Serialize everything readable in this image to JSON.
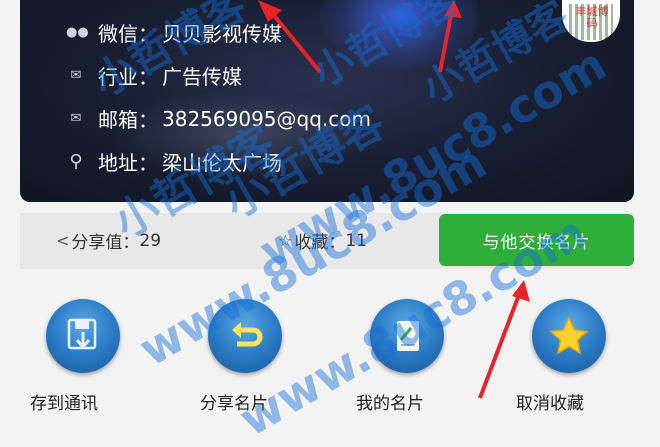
{
  "card": {
    "wechat": {
      "icon": "wechat-icon",
      "label": "微信：",
      "value": "贝贝影视传媒"
    },
    "industry": {
      "icon": "mail-icon",
      "label": "行业：",
      "value": "广告传媒"
    },
    "email": {
      "icon": "mail-icon",
      "label": "邮箱：",
      "value": "382569095@qq.com"
    },
    "address": {
      "icon": "location-pin-icon",
      "label": "地址：",
      "value": "梁山伦太广场"
    },
    "qr_caption": "丰城博码"
  },
  "stats": {
    "share": {
      "icon": "share-icon",
      "label": "分享值：",
      "value": "29"
    },
    "fav": {
      "icon": "star-outline-icon",
      "label": "收藏：",
      "value": "11"
    },
    "exchange_button": "与他交换名片"
  },
  "actions": [
    {
      "icon": "save-download-icon",
      "label": "存到通讯"
    },
    {
      "icon": "return-icon",
      "label": "分享名片"
    },
    {
      "icon": "notebook-icon",
      "label": "我的名片"
    },
    {
      "icon": "star-icon",
      "label": "取消收藏"
    }
  ],
  "watermark": {
    "text1": "小哲博客",
    "text2": "www.8uc8.com",
    "color": "#1e6fdc"
  },
  "colors": {
    "accent_green": "#2eae3a",
    "card_dark": "#1a2035",
    "action_blue": "#2e7fc9"
  }
}
